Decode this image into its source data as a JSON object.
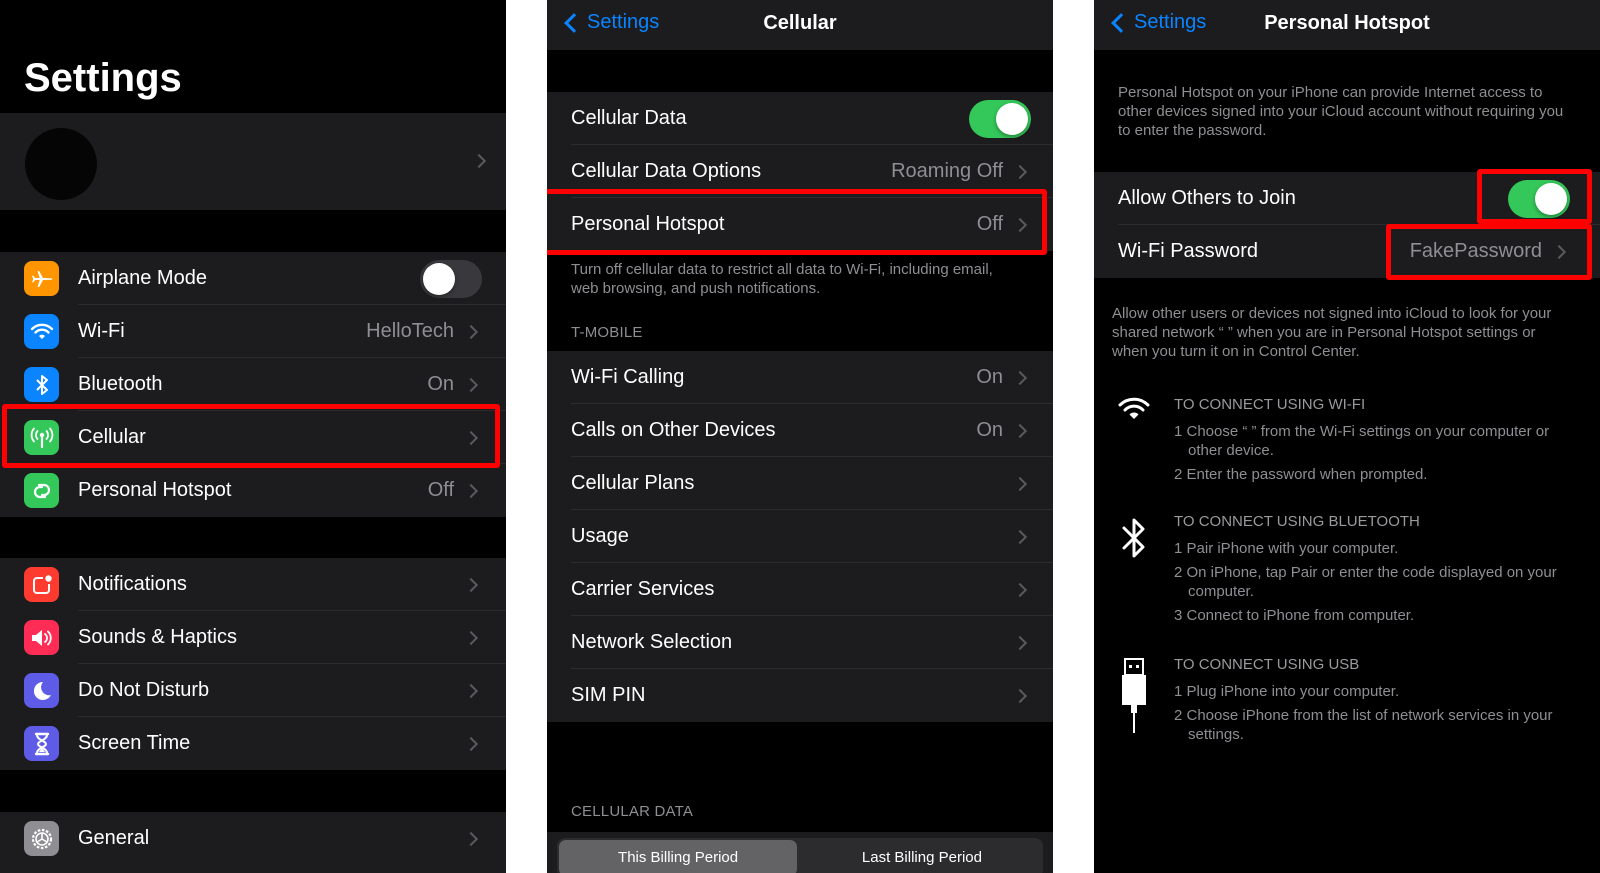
{
  "settings_panel": {
    "title": "Settings",
    "profile": {
      "name": "",
      "avatar": "avatar"
    },
    "groups": [
      [
        {
          "label": "Airplane Mode",
          "icon": "airplane-icon",
          "icon_color": "#ff9500",
          "toggle": false
        },
        {
          "label": "Wi-Fi",
          "icon": "wifi-icon",
          "icon_color": "#0a84ff",
          "value": "HelloTech"
        },
        {
          "label": "Bluetooth",
          "icon": "bluetooth-icon",
          "icon_color": "#0a84ff",
          "value": "On"
        },
        {
          "label": "Cellular",
          "icon": "cellular-antenna-icon",
          "icon_color": "#34c759",
          "value": "",
          "highlighted": true
        },
        {
          "label": "Personal Hotspot",
          "icon": "hotspot-icon",
          "icon_color": "#34c759",
          "value": "Off"
        }
      ],
      [
        {
          "label": "Notifications",
          "icon": "notifications-icon",
          "icon_color": "#ff3b30"
        },
        {
          "label": "Sounds & Haptics",
          "icon": "speaker-icon",
          "icon_color": "#ff2d55"
        },
        {
          "label": "Do Not Disturb",
          "icon": "moon-icon",
          "icon_color": "#5e5ce6"
        },
        {
          "label": "Screen Time",
          "icon": "hourglass-icon",
          "icon_color": "#5e5ce6"
        }
      ],
      [
        {
          "label": "General",
          "icon": "gear-icon",
          "icon_color": "#8e8e93"
        }
      ]
    ]
  },
  "cellular_panel": {
    "back_label": "Settings",
    "title": "Cellular",
    "top_group": [
      {
        "label": "Cellular Data",
        "toggle": true
      },
      {
        "label": "Cellular Data Options",
        "value": "Roaming Off"
      },
      {
        "label": "Personal Hotspot",
        "value": "Off",
        "highlighted": true
      }
    ],
    "footnote": "Turn off cellular data to restrict all data to Wi-Fi, including email, web browsing, and push notifications.",
    "carrier_header": "T-MOBILE",
    "carrier_group": [
      {
        "label": "Wi-Fi Calling",
        "value": "On"
      },
      {
        "label": "Calls on Other Devices",
        "value": "On"
      },
      {
        "label": "Cellular Plans",
        "value": ""
      },
      {
        "label": "Usage",
        "value": ""
      },
      {
        "label": "Carrier Services",
        "value": ""
      },
      {
        "label": "Network Selection",
        "value": ""
      },
      {
        "label": "SIM PIN",
        "value": ""
      }
    ],
    "data_header": "CELLULAR DATA",
    "segments": [
      "This Billing Period",
      "Last Billing Period"
    ],
    "active_segment": 0
  },
  "hotspot_panel": {
    "back_label": "Settings",
    "title": "Personal Hotspot",
    "intro": "Personal Hotspot on your iPhone can provide Internet access to other devices signed into your iCloud account without requiring you to enter the password.",
    "rows": [
      {
        "label": "Allow Others to Join",
        "toggle": true,
        "highlighted": true
      },
      {
        "label": "Wi-Fi Password",
        "value": "FakePassword",
        "highlighted": true
      }
    ],
    "allow_note": "Allow other users or devices not signed into iCloud to look for your shared network “          ” when you are in Personal Hotspot settings or when you turn it on in Control Center.",
    "connect_sections": [
      {
        "icon": "wifi-icon",
        "title": "TO CONNECT USING WI-FI",
        "steps": [
          "1 Choose “        ” from the Wi-Fi settings on your computer or other device.",
          "2 Enter the password when prompted."
        ]
      },
      {
        "icon": "bluetooth-icon",
        "title": "TO CONNECT USING BLUETOOTH",
        "steps": [
          "1 Pair iPhone with your computer.",
          "2 On iPhone, tap Pair or enter the code displayed on your computer.",
          "3 Connect to iPhone from computer."
        ]
      },
      {
        "icon": "usb-icon",
        "title": "TO CONNECT USING USB",
        "steps": [
          "1 Plug iPhone into your computer.",
          "2 Choose iPhone from the list of network services in your settings."
        ]
      }
    ]
  }
}
